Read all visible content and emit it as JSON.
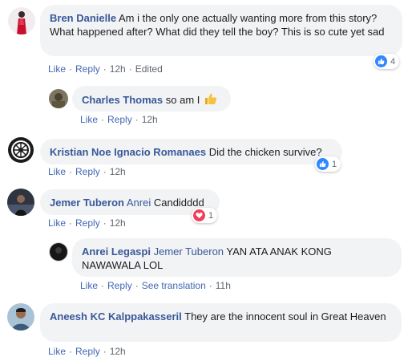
{
  "comments": [
    {
      "author": "Bren Danielle",
      "text": "Am i the only one actually wanting more from this story? What happened after? What did they tell the boy? This is so cute yet sad",
      "like_label": "Like",
      "reply_label": "Reply",
      "time": "12h",
      "edited": "Edited",
      "reaction_count": "4",
      "reaction_icon": "like-icon",
      "replies": [
        {
          "author": "Charles Thomas",
          "text": "so am I",
          "emoji": "thumbs-up-emoji",
          "like_label": "Like",
          "reply_label": "Reply",
          "time": "12h"
        }
      ]
    },
    {
      "author": "Kristian Noe Ignacio Romanaes",
      "text": "Did the chicken survive?",
      "like_label": "Like",
      "reply_label": "Reply",
      "time": "12h",
      "reaction_count": "1",
      "reaction_icon": "like-icon"
    },
    {
      "author": "Jemer Tuberon",
      "tag": "Anrei",
      "text": "Candidddd",
      "like_label": "Like",
      "reply_label": "Reply",
      "time": "12h",
      "reaction_count": "1",
      "reaction_icon": "love-icon",
      "replies": [
        {
          "author": "Anrei Legaspi",
          "tag": "Jemer Tuberon",
          "text": "YAN ATA ANAK KONG NAWAWALA LOL",
          "like_label": "Like",
          "reply_label": "Reply",
          "translate_label": "See translation",
          "time": "11h"
        }
      ]
    },
    {
      "author": "Aneesh KC Kalppakasseril",
      "text": "They are the innocent soul in Great Heaven",
      "like_label": "Like",
      "reply_label": "Reply",
      "time": "12h"
    }
  ],
  "colors": {
    "link": "#4267b2",
    "author": "#385898",
    "bubble": "#f2f3f5",
    "meta": "#606770",
    "like_reaction": "#2d88ff",
    "love_reaction": "#f33e58"
  }
}
